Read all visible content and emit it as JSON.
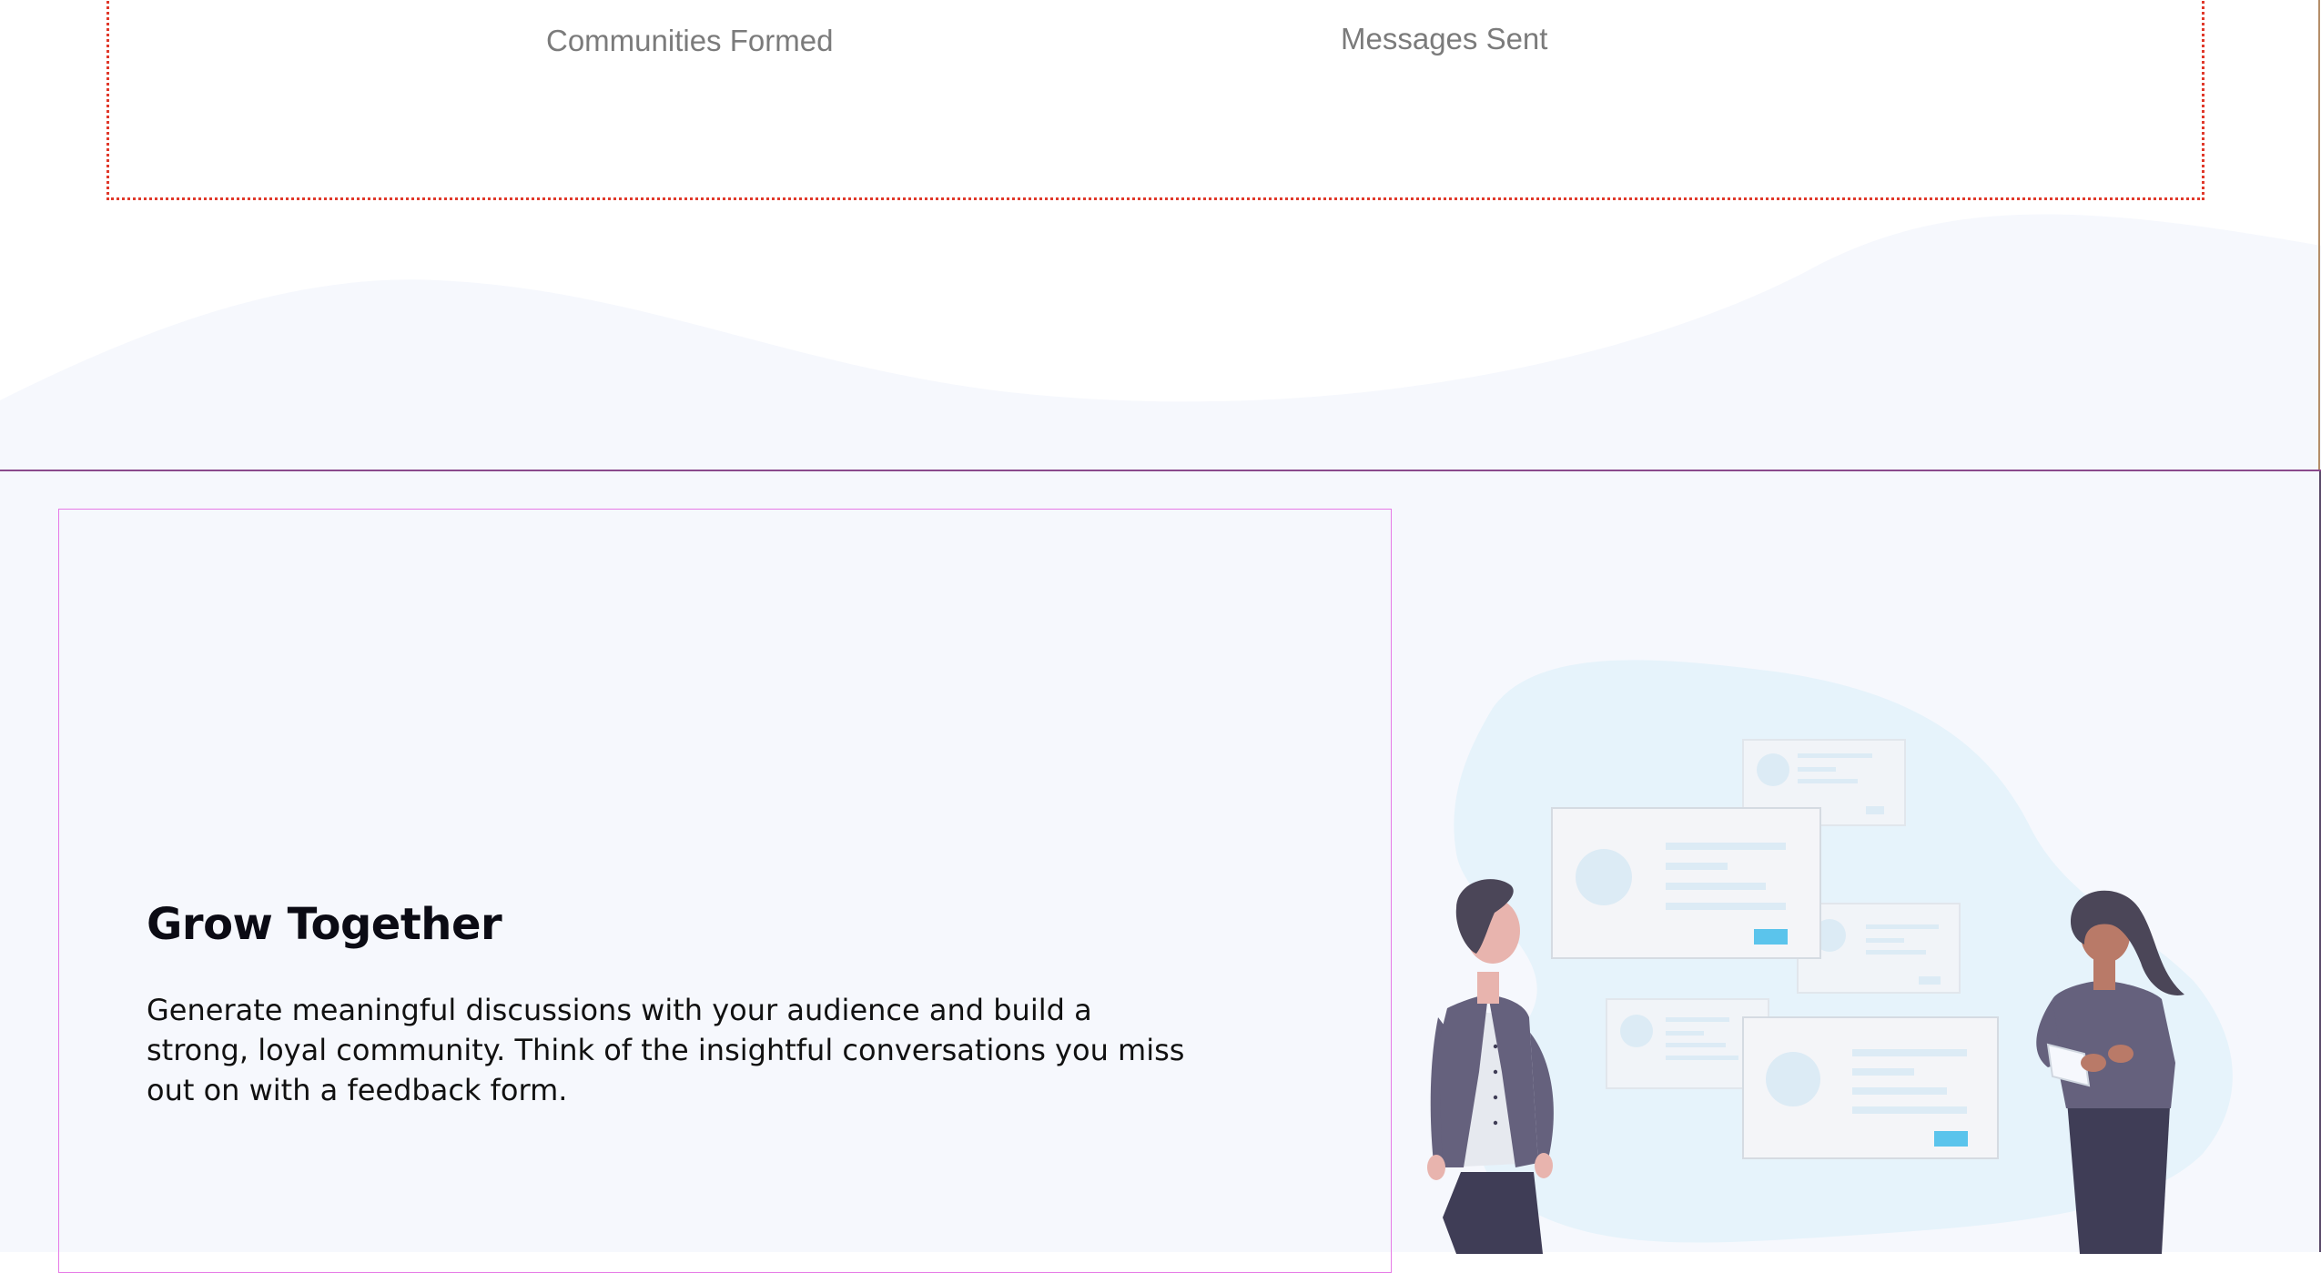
{
  "stats": {
    "items": [
      {
        "label": "Communities Formed"
      },
      {
        "label": "Messages Sent"
      }
    ]
  },
  "feature": {
    "title": "Grow Together",
    "body": "Generate meaningful discussions with your audience and build a strong, loyal community. Think of the insightful conversations you miss out on with a feedback form."
  },
  "colors": {
    "dotted_border": "#e0392b",
    "section_background": "#f6f8fd",
    "section_divider": "#8a4a8c",
    "column_outline": "#e67ae6",
    "blob": "#e6f3fb",
    "accent_button": "#5bc4ec"
  },
  "icons": {
    "illustration": "people-with-conversation-cards-illustration"
  }
}
